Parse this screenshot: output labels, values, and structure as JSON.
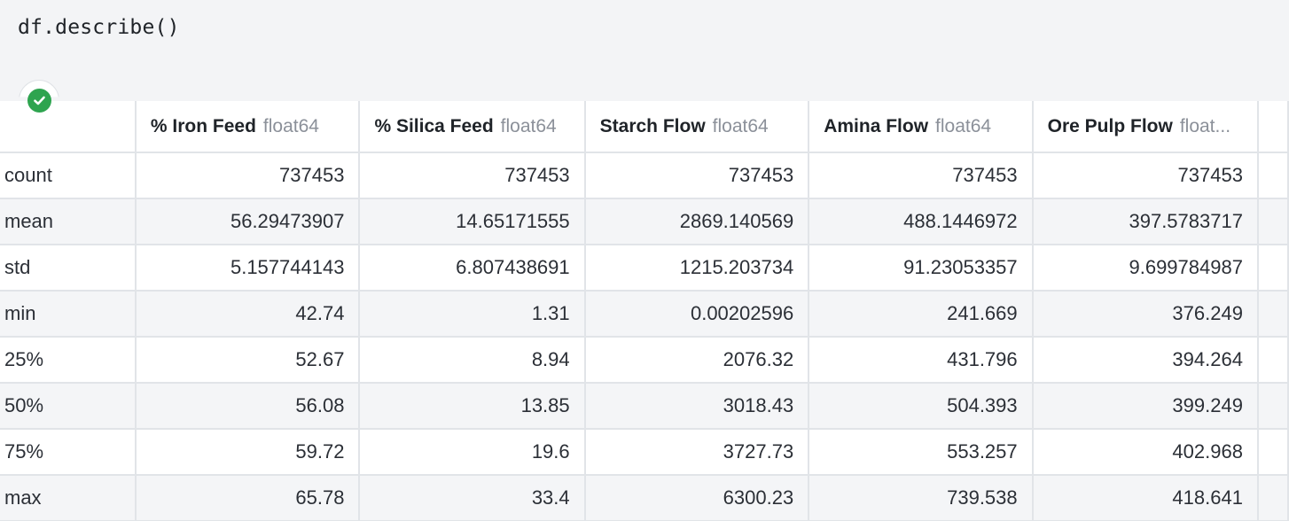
{
  "code": "df.describe()",
  "status_icon": "check-circle-icon",
  "columns": [
    {
      "name": "% Iron Feed",
      "type": "float64"
    },
    {
      "name": "% Silica Feed",
      "type": "float64"
    },
    {
      "name": "Starch Flow",
      "type": "float64"
    },
    {
      "name": "Amina Flow",
      "type": "float64"
    },
    {
      "name": "Ore Pulp Flow",
      "type": "float..."
    }
  ],
  "rows": [
    {
      "label": "count",
      "values": [
        "737453",
        "737453",
        "737453",
        "737453",
        "737453"
      ]
    },
    {
      "label": "mean",
      "values": [
        "56.29473907",
        "14.65171555",
        "2869.140569",
        "488.1446972",
        "397.5783717"
      ]
    },
    {
      "label": "std",
      "values": [
        "5.157744143",
        "6.807438691",
        "1215.203734",
        "91.23053357",
        "9.699784987"
      ]
    },
    {
      "label": "min",
      "values": [
        "42.74",
        "1.31",
        "0.00202596",
        "241.669",
        "376.249"
      ]
    },
    {
      "label": "25%",
      "values": [
        "52.67",
        "8.94",
        "2076.32",
        "431.796",
        "394.264"
      ]
    },
    {
      "label": "50%",
      "values": [
        "56.08",
        "13.85",
        "3018.43",
        "504.393",
        "399.249"
      ]
    },
    {
      "label": "75%",
      "values": [
        "59.72",
        "19.6",
        "3727.73",
        "553.257",
        "402.968"
      ]
    },
    {
      "label": "max",
      "values": [
        "65.78",
        "33.4",
        "6300.23",
        "739.538",
        "418.641"
      ]
    }
  ],
  "colors": {
    "success": "#2ea44f",
    "border": "#e1e4e8",
    "stripe": "#f4f5f7",
    "code_bg": "#f3f4f6"
  }
}
